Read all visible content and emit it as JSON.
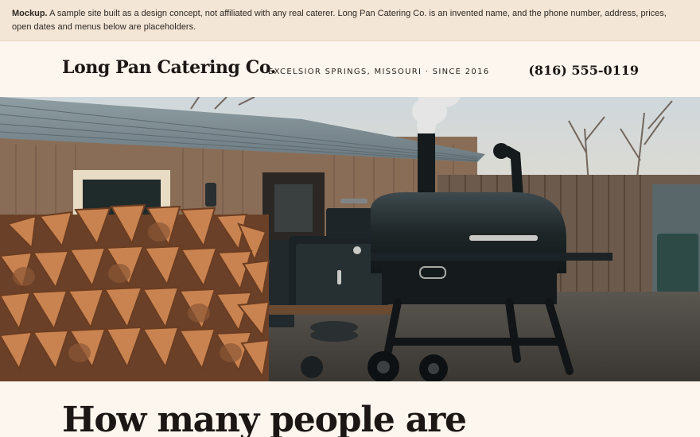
{
  "notice": {
    "label": "Mockup.",
    "text": " A sample site built as a design concept, not affiliated with any real caterer. Long Pan Catering Co. is an invented name, and the phone number, address, prices, open dates and menus below are placeholders."
  },
  "header": {
    "brand": "Long Pan Catering Co.",
    "tagline": "EXCELSIOR SPRINGS, MISSOURI · SINCE 2016",
    "phone": "(816) 555-0119"
  },
  "hero": {
    "image_subject": "smoker-and-firewood-photo"
  },
  "main": {
    "headline": "How many people are"
  },
  "colors": {
    "page_bg": "#fdf6ee",
    "notice_bg": "#f3e6d6",
    "text": "#1c1714"
  }
}
